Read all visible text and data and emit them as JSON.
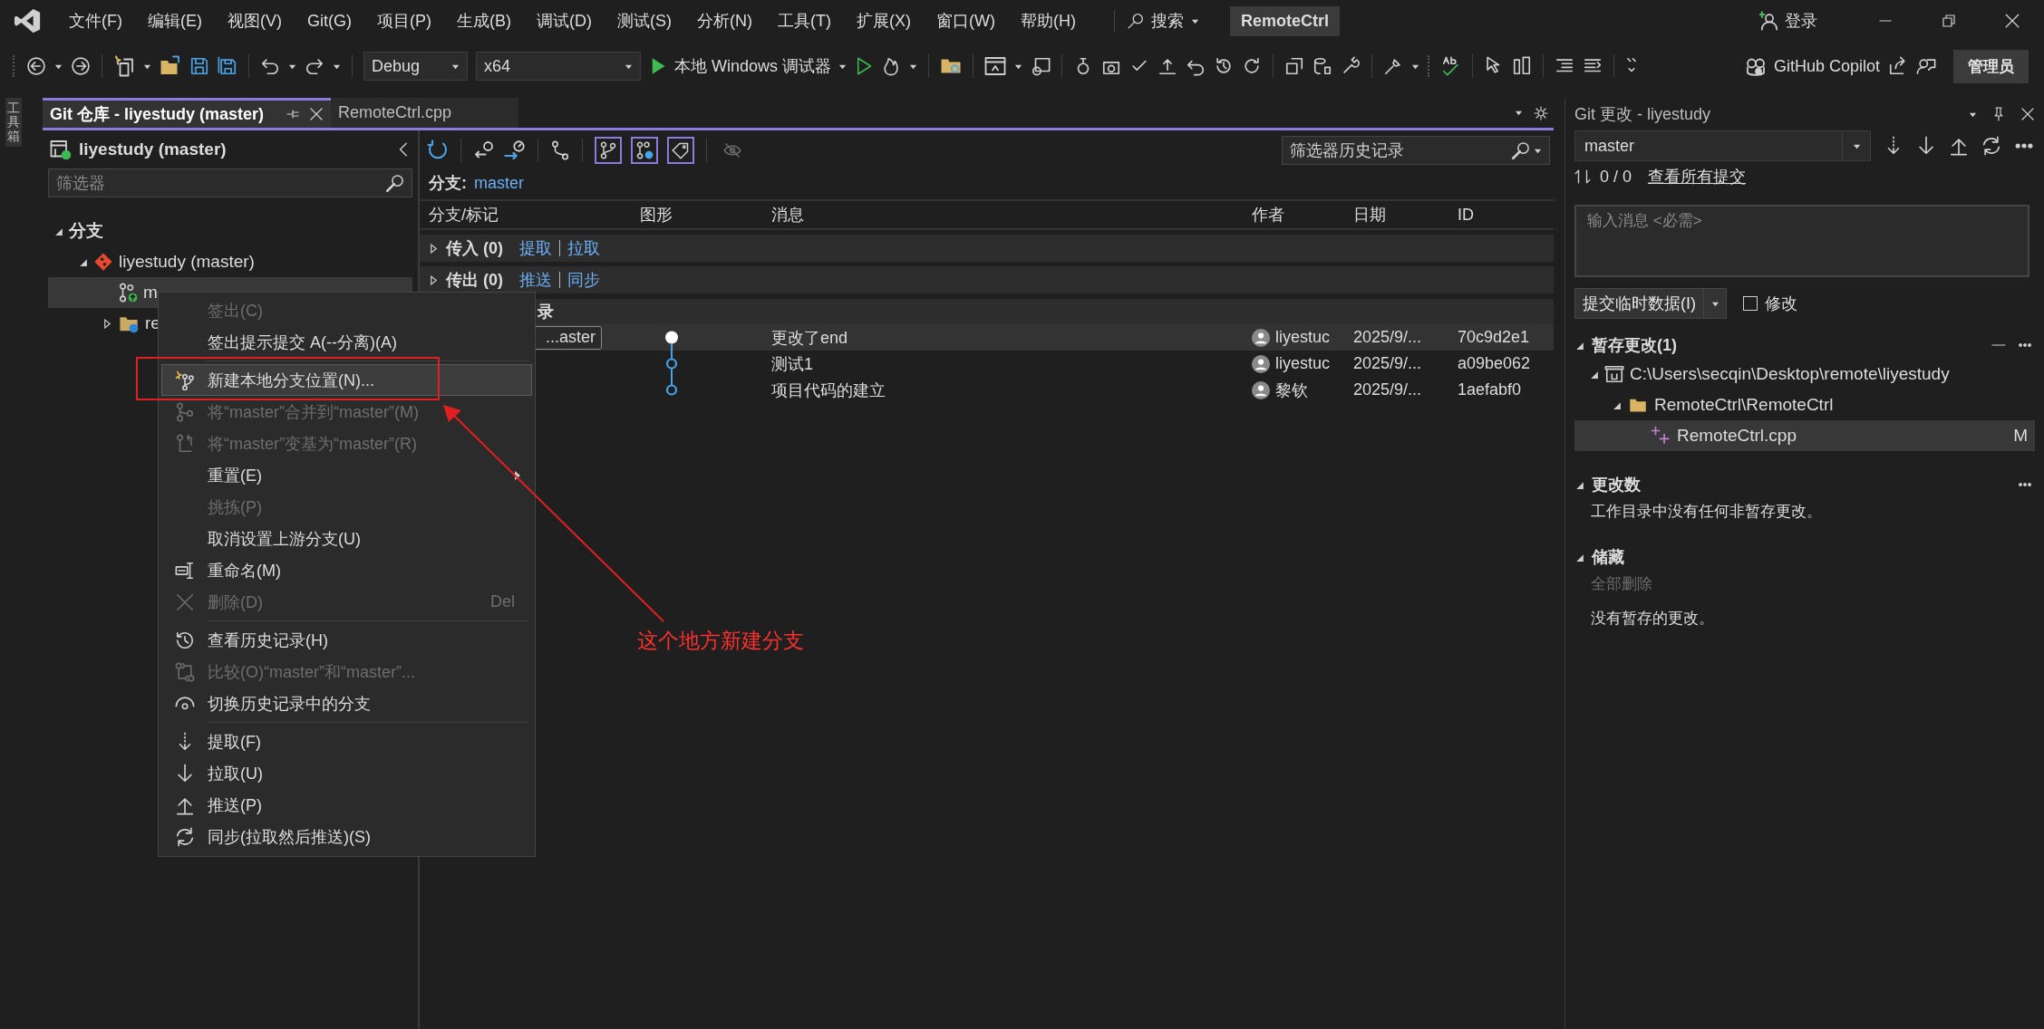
{
  "menu_bar": {
    "items": [
      "文件(F)",
      "编辑(E)",
      "视图(V)",
      "Git(G)",
      "项目(P)",
      "生成(B)",
      "调试(D)",
      "测试(S)",
      "分析(N)",
      "工具(T)",
      "扩展(X)",
      "窗口(W)",
      "帮助(H)"
    ],
    "search": "搜索",
    "solution": "RemoteCtrl",
    "sign_in": "登录"
  },
  "toolbar": {
    "configuration": "Debug",
    "platform": "x64",
    "debugger": "本地 Windows 调试器",
    "copilot": "GitHub Copilot",
    "admin": "管理员"
  },
  "toolbox_label": "工具箱",
  "doc_tabs": [
    {
      "label": "Git 仓库 - liyestudy (master)",
      "selected": true
    },
    {
      "label": "RemoteCtrl.cpp",
      "selected": false
    }
  ],
  "branches_pane": {
    "title": "liyestudy (master)",
    "filter_placeholder": "筛选器",
    "tree": [
      {
        "kind": "section",
        "label": "分支",
        "expanded": true,
        "children": [
          {
            "kind": "repo",
            "label": "liyestudy (master)",
            "expanded": true,
            "children": [
              {
                "kind": "branch",
                "label": "m",
                "selected": true
              },
              {
                "kind": "remotes",
                "label": "re",
                "expanded": false,
                "selected": false
              }
            ]
          }
        ]
      }
    ]
  },
  "history": {
    "view_toggles": [
      {
        "selected": true
      },
      {
        "selected": true
      },
      {
        "selected": true
      },
      {
        "selected": false
      }
    ],
    "filter_placeholder": "筛选器历史记录",
    "branch_label": "分支:",
    "branch": "master",
    "columns": [
      "分支/标记",
      "图形",
      "消息",
      "作者",
      "日期",
      "ID"
    ],
    "groups": [
      {
        "label": "传入 (0)",
        "expanded": false,
        "links": [
          "提取",
          "拉取"
        ]
      },
      {
        "label": "传出 (0)",
        "expanded": false,
        "links": [
          "推送",
          "同步"
        ]
      }
    ],
    "local_heading": "录",
    "commits": [
      {
        "tag": "...aster",
        "message": "更改了end",
        "author": "liyestuc",
        "date": "2025/9/...",
        "id": "70c9d2e1",
        "selected": true,
        "current": true
      },
      {
        "message": "测试1",
        "author": "liyestuc",
        "date": "2025/9/...",
        "id": "a09be062",
        "selected": false,
        "current": false
      },
      {
        "message": "项目代码的建立",
        "author": "黎钦",
        "date": "2025/9/...",
        "id": "1aefabf0",
        "selected": false,
        "current": false
      }
    ]
  },
  "context_menu": {
    "items": [
      {
        "kind": "item",
        "label": "签出(C)",
        "disabled": true,
        "selected": false
      },
      {
        "kind": "item",
        "label": "签出提示提交 A(--分离)(A)",
        "disabled": false,
        "selected": false
      },
      {
        "kind": "separator"
      },
      {
        "kind": "item",
        "label": "新建本地分支位置(N)...",
        "disabled": false,
        "selected": true
      },
      {
        "kind": "item",
        "label": "将“master”合并到“master”(M)",
        "disabled": true,
        "selected": false
      },
      {
        "kind": "item",
        "label": "将“master”变基为“master”(R)",
        "disabled": true,
        "selected": false
      },
      {
        "kind": "item",
        "label": "重置(E)",
        "disabled": false,
        "selected": false,
        "submenu": true
      },
      {
        "kind": "item",
        "label": "挑拣(P)",
        "disabled": true,
        "selected": false
      },
      {
        "kind": "item",
        "label": "取消设置上游分支(U)",
        "disabled": false,
        "selected": false
      },
      {
        "kind": "item",
        "label": "重命名(M)",
        "disabled": false,
        "selected": false
      },
      {
        "kind": "item",
        "label": "删除(D)",
        "disabled": true,
        "selected": false,
        "shortcut": "Del"
      },
      {
        "kind": "separator"
      },
      {
        "kind": "item",
        "label": "查看历史记录(H)",
        "disabled": false,
        "selected": false
      },
      {
        "kind": "item",
        "label": "比较(O)“master”和“master”...",
        "disabled": true,
        "selected": false
      },
      {
        "kind": "item",
        "label": "切换历史记录中的分支",
        "disabled": false,
        "selected": false
      },
      {
        "kind": "separator"
      },
      {
        "kind": "item",
        "label": "提取(F)",
        "disabled": false,
        "selected": false
      },
      {
        "kind": "item",
        "label": "拉取(U)",
        "disabled": false,
        "selected": false
      },
      {
        "kind": "item",
        "label": "推送(P)",
        "disabled": false,
        "selected": false
      },
      {
        "kind": "item",
        "label": "同步(拉取然后推送)(S)",
        "disabled": false,
        "selected": false
      }
    ]
  },
  "annotation": {
    "text": "这个地方新建分支"
  },
  "git_changes": {
    "title": "Git 更改 - liyestudy",
    "branch": "master",
    "counts": "0 / 0",
    "all_commits_link": "查看所有提交",
    "message_placeholder": "输入消息 <必需>",
    "commit_button": "提交临时数据(I)",
    "amend": {
      "label": "修改",
      "checked": false
    },
    "staged": {
      "title": "暂存更改(1)",
      "expanded": true,
      "tree": [
        {
          "kind": "root",
          "label": "C:\\Users\\secqin\\Desktop\\remote\\liyestudy",
          "expanded": true,
          "children": [
            {
              "kind": "folder",
              "label": "RemoteCtrl\\RemoteCtrl",
              "expanded": true,
              "children": [
                {
                  "kind": "file",
                  "label": "RemoteCtrl.cpp",
                  "status": "M",
                  "selected": true
                }
              ]
            }
          ]
        }
      ]
    },
    "changes": {
      "title": "更改数",
      "expanded": true,
      "message": "工作目录中没有任何非暂存更改。"
    },
    "stashes": {
      "title": "储藏",
      "expanded": true,
      "action": "全部删除",
      "message": "没有暂存的更改。"
    }
  }
}
